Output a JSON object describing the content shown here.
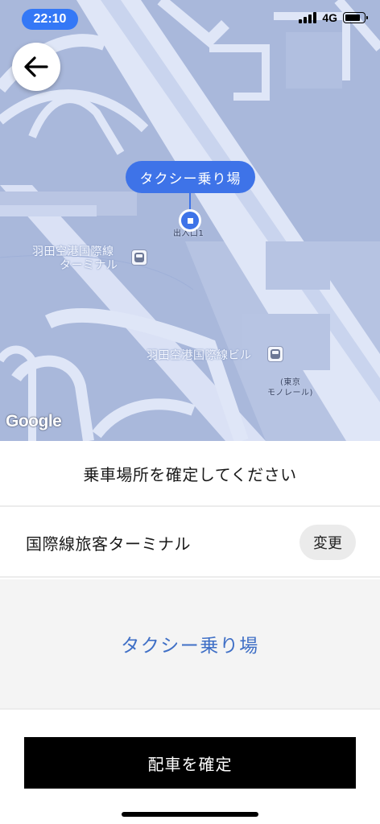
{
  "status_bar": {
    "time": "22:10",
    "network": "4G"
  },
  "map": {
    "pickup_label": "タクシー乗り場",
    "entrance_label": "出入口1",
    "poi": {
      "terminal_line1": "羽田空港国際線",
      "terminal_line2": "ターミナル",
      "building": "羽田空港国際線ビル",
      "monorail_line1": "(東京",
      "monorail_line2": "モノレール)"
    },
    "attribution": "Google"
  },
  "sheet": {
    "title": "乗車場所を確定してください",
    "location_name": "国際線旅客ターミナル",
    "change_label": "変更",
    "spot_name": "タクシー乗り場",
    "confirm_label": "配車を確定"
  },
  "colors": {
    "accent": "#3e73e8",
    "map_bg": "#a9b8db",
    "road": "#dfe6f7"
  }
}
